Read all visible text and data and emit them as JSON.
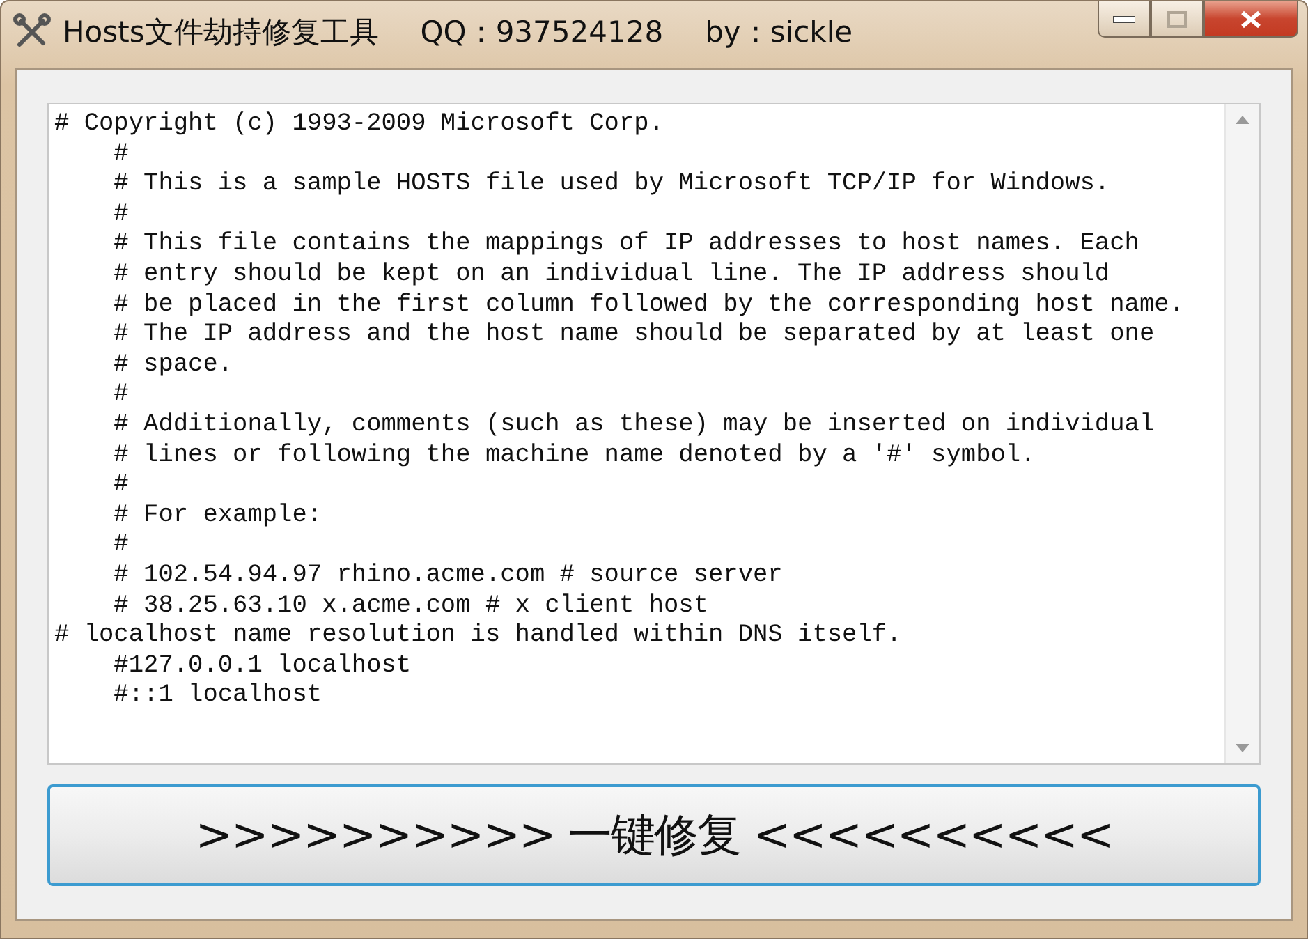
{
  "window": {
    "title": "Hosts文件劫持修复工具",
    "qq": "QQ：937524128",
    "author": "by：sickle",
    "maximize_disabled": true
  },
  "editor": {
    "lines": [
      "# Copyright (c) 1993-2009 Microsoft Corp.",
      "    #",
      "    # This is a sample HOSTS file used by Microsoft TCP/IP for Windows.",
      "    #",
      "    # This file contains the mappings of IP addresses to host names. Each",
      "    # entry should be kept on an individual line. The IP address should",
      "    # be placed in the first column followed by the corresponding host name.",
      "    # The IP address and the host name should be separated by at least one",
      "    # space.",
      "    #",
      "    # Additionally, comments (such as these) may be inserted on individual",
      "    # lines or following the machine name denoted by a '#' symbol.",
      "    #",
      "    # For example:",
      "    #",
      "    # 102.54.94.97 rhino.acme.com # source server",
      "    # 38.25.63.10 x.acme.com # x client host",
      "# localhost name resolution is handled within DNS itself.",
      "    #127.0.0.1 localhost",
      "    #::1 localhost"
    ]
  },
  "fix_button": {
    "label": ">>>>>>>>>> 一键修复 <<<<<<<<<<"
  }
}
